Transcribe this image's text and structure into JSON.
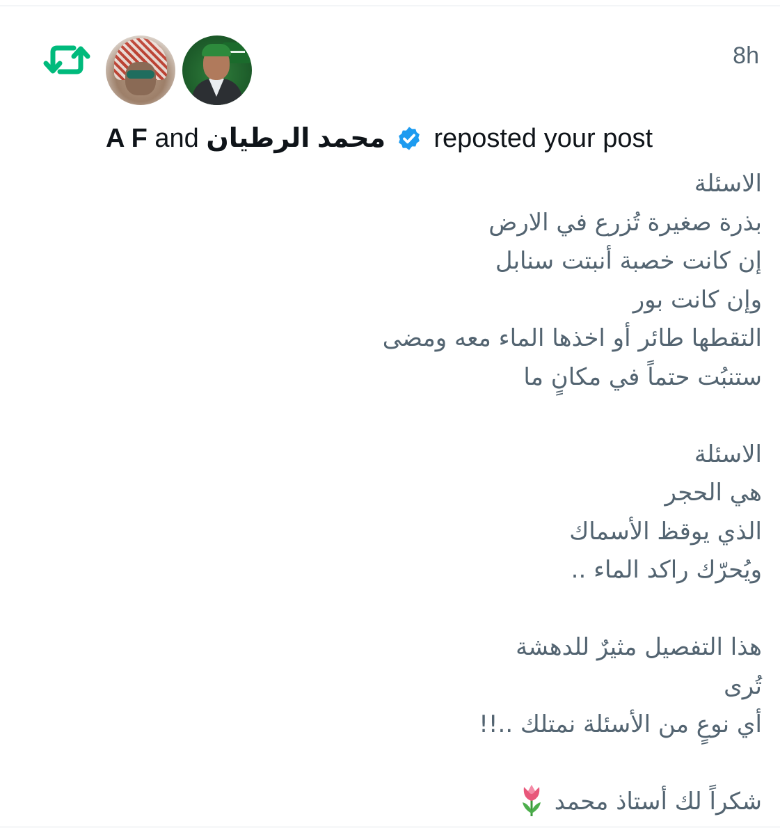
{
  "notification": {
    "timestamp": "8h",
    "actors": [
      {
        "name": "A F",
        "avatar": "avatar-af"
      },
      {
        "name": "محمد الرطيان",
        "avatar": "avatar-mr",
        "verified": true
      }
    ],
    "actor_1": "A F",
    "connector": "and",
    "actor_2": "محمد الرطيان",
    "action": "reposted your post",
    "icons": {
      "repost": "repost-icon",
      "verified": "verified-badge-icon",
      "emoji": "tulip-icon"
    },
    "colors": {
      "repost_green": "#00ba7c",
      "verified_blue": "#1d9bf0",
      "secondary_text": "#536471",
      "primary_text": "#0f1419"
    }
  },
  "post": {
    "lines": [
      "الاسئلة",
      "بذرة صغيرة تُزرع في الارض",
      "إن كانت خصبة أنبتت سنابل",
      "وإن كانت بور",
      "التقطها طائر أو اخذها الماء معه ومضى",
      "ستنبُت حتماً في مكانٍ ما",
      "",
      "الاسئلة",
      "هي الحجر",
      "الذي يوقظ الأسماك",
      "ويُحرّك راكد الماء ..",
      "",
      "هذا التفصيل مثيرٌ للدهشة",
      "تُرى",
      "أي نوعٍ من الأسئلة نمتلك ..!!",
      "",
      "شكراً لك أستاذ محمد"
    ]
  }
}
